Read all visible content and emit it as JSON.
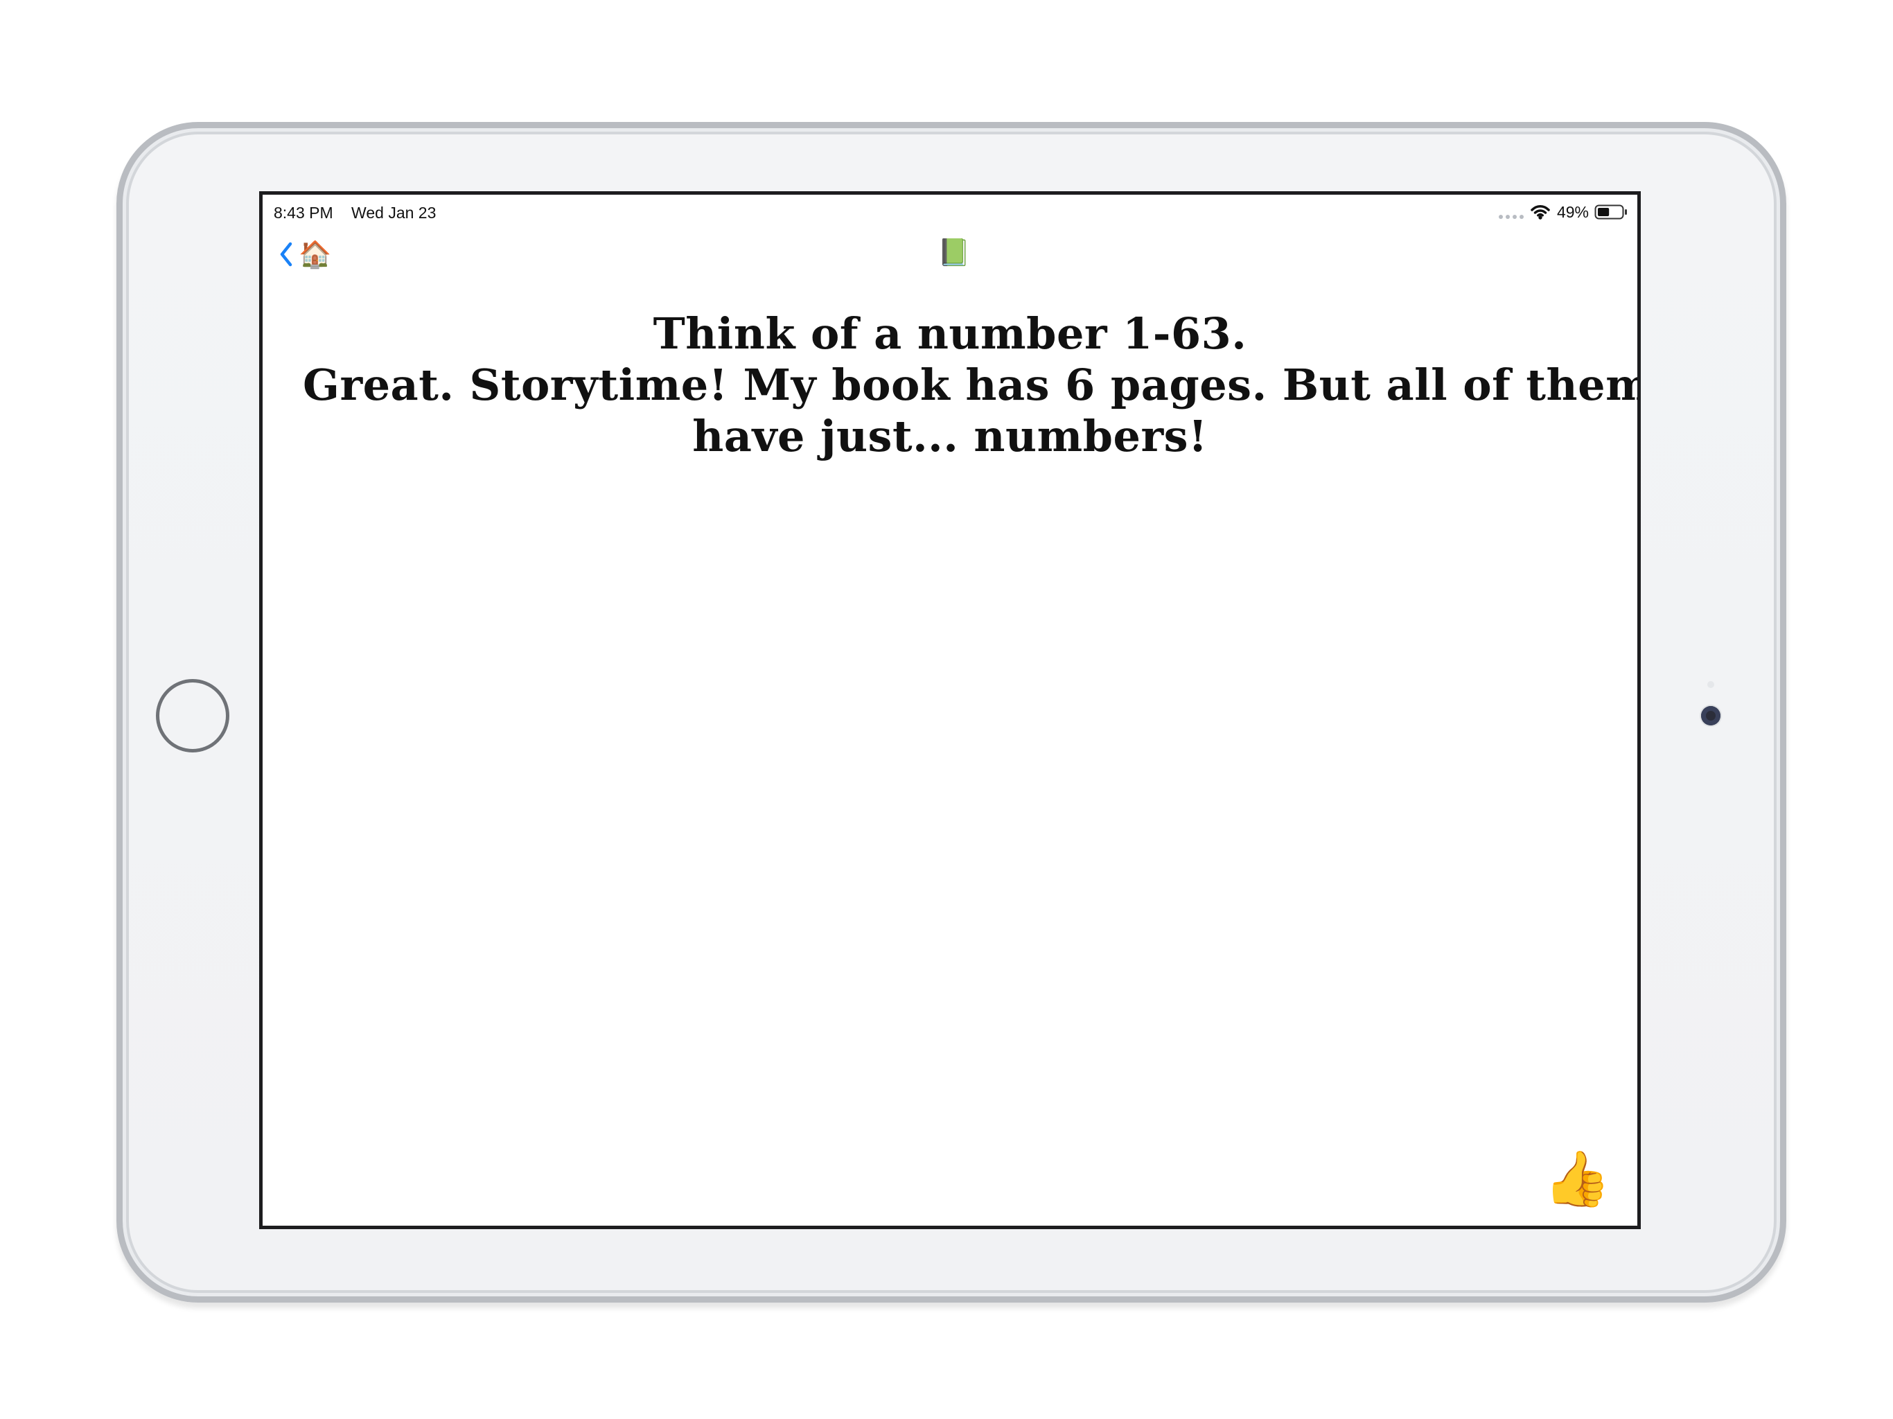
{
  "status_bar": {
    "time": "8:43 PM",
    "date": "Wed Jan 23",
    "battery_percent": "49%",
    "battery_level": 0.49,
    "wifi_icon": "wifi-icon",
    "cellular_icon": "signal-dots-icon",
    "battery_icon": "battery-icon"
  },
  "navigation": {
    "back_icon": "chevron-left-icon",
    "back_emoji": "🏠",
    "title_emoji": "📗"
  },
  "content": {
    "line_1": "Think of a number 1-63.",
    "line_2": "Great. Storytime! My book has 6 pages. But all of them",
    "line_3": "have just... numbers!"
  },
  "actions": {
    "confirm_emoji": "👍"
  },
  "colors": {
    "accent": "#1a82f7",
    "text": "#111111",
    "screen_border": "#1d1d1f",
    "device_body": "#f3f4f6"
  }
}
